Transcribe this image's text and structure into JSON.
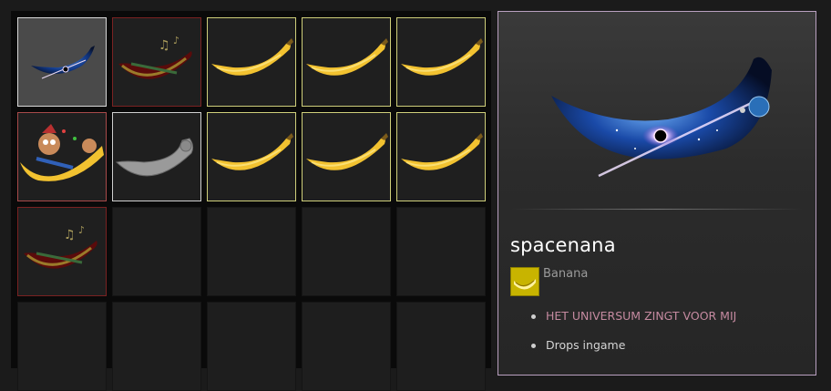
{
  "inventory": {
    "slots": [
      {
        "id": 1,
        "item": "spacenana",
        "icon": "space-banana-icon",
        "rarity": "selected"
      },
      {
        "id": 2,
        "item": "music banana",
        "icon": "music-banana-icon",
        "rarity": "rare"
      },
      {
        "id": 3,
        "item": "banana",
        "icon": "banana-icon",
        "rarity": "common"
      },
      {
        "id": 4,
        "item": "banana",
        "icon": "banana-icon",
        "rarity": "common"
      },
      {
        "id": 5,
        "item": "banana",
        "icon": "banana-icon",
        "rarity": "common"
      },
      {
        "id": 6,
        "item": "party banana",
        "icon": "party-banana-icon",
        "rarity": "special"
      },
      {
        "id": 7,
        "item": "grey banana",
        "icon": "grey-banana-icon",
        "rarity": "white"
      },
      {
        "id": 8,
        "item": "banana",
        "icon": "banana-icon",
        "rarity": "common"
      },
      {
        "id": 9,
        "item": "banana",
        "icon": "banana-icon",
        "rarity": "common"
      },
      {
        "id": 10,
        "item": "banana",
        "icon": "banana-icon",
        "rarity": "common"
      },
      {
        "id": 11,
        "item": "music banana",
        "icon": "music-banana-icon",
        "rarity": "rare"
      }
    ]
  },
  "detail": {
    "name": "spacenana",
    "game": "Banana",
    "game_icon": "banana-game-icon",
    "tags": [
      "HET UNIVERSUM ZINGT VOOR MIJ",
      "Drops ingame"
    ],
    "tag_colors": [
      "#c58aa0",
      "#d4d4d4"
    ]
  },
  "colors": {
    "panel_border": "#b9a0c0",
    "common_border": "#cfcf7a",
    "rare_border": "#7a2222"
  }
}
